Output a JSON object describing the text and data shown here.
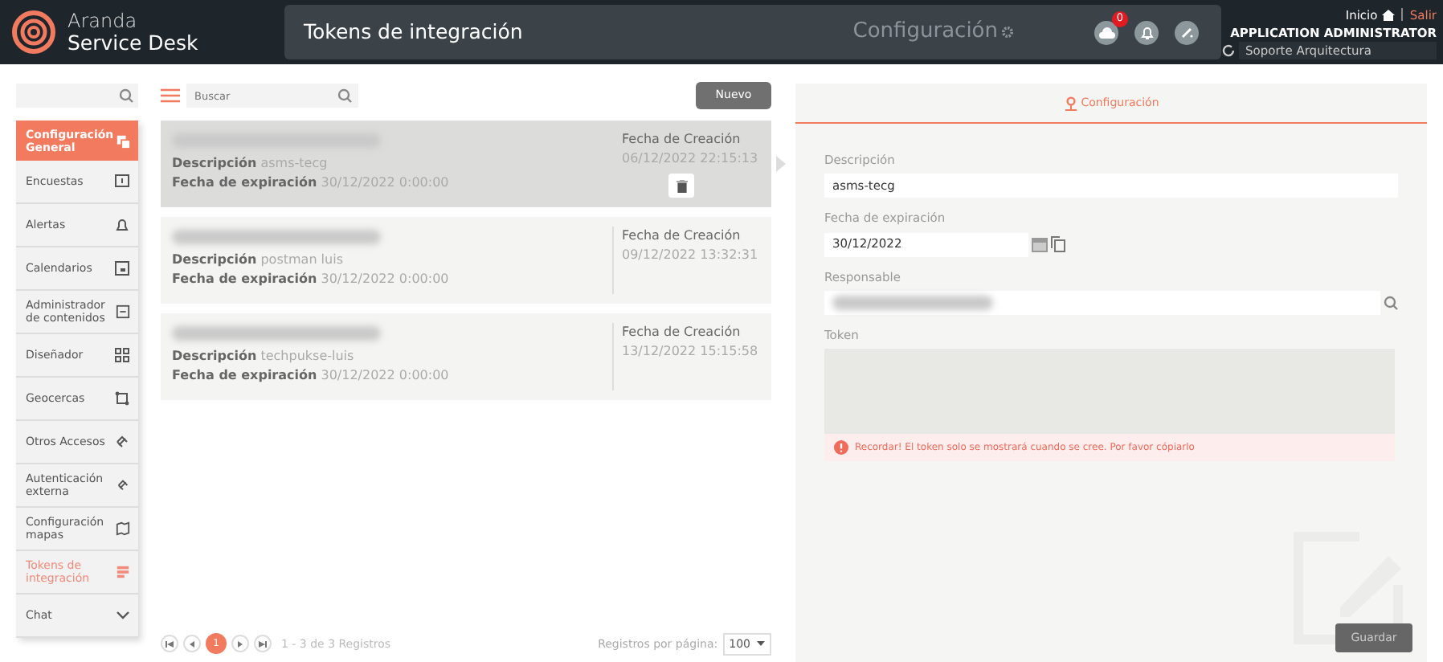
{
  "header": {
    "brand_top": "Aranda",
    "brand_bottom": "Service Desk",
    "title": "Tokens de integración",
    "section": "Configuración",
    "notifications_badge": "0",
    "home_link": "Inicio",
    "logout_link": "Salir",
    "user": "APPLICATION ADMINISTRATOR",
    "project": "Soporte Arquitectura"
  },
  "sidebar": {
    "items": [
      {
        "label": "Configuración General",
        "kind": "section",
        "selected": false
      },
      {
        "label": "Encuestas",
        "kind": "link",
        "selected": false
      },
      {
        "label": "Alertas",
        "kind": "link",
        "selected": false
      },
      {
        "label": "Calendarios",
        "kind": "link",
        "selected": false
      },
      {
        "label": "Administrador de contenidos",
        "kind": "link",
        "selected": false
      },
      {
        "label": "Diseñador",
        "kind": "link",
        "selected": false
      },
      {
        "label": "Geocercas",
        "kind": "link",
        "selected": false
      },
      {
        "label": "Otros Accesos",
        "kind": "link",
        "selected": false
      },
      {
        "label": "Autenticación externa",
        "kind": "link",
        "selected": false
      },
      {
        "label": "Configuración mapas",
        "kind": "link",
        "selected": false
      },
      {
        "label": "Tokens de integración",
        "kind": "link",
        "selected": true
      },
      {
        "label": "Chat",
        "kind": "expandable",
        "selected": false
      }
    ]
  },
  "list": {
    "search_placeholder": "Buscar",
    "new_button": "Nuevo",
    "cards": [
      {
        "description_label": "Descripción",
        "description": "asms-tecg",
        "expiry_label": "Fecha de expiración",
        "expiry": "30/12/2022 0:00:00",
        "created_label": "Fecha de Creación",
        "created": "06/12/2022 22:15:13",
        "selected": true
      },
      {
        "description_label": "Descripción",
        "description": "postman luis",
        "expiry_label": "Fecha de expiración",
        "expiry": "30/12/2022 0:00:00",
        "created_label": "Fecha de Creación",
        "created": "09/12/2022 13:32:31",
        "selected": false
      },
      {
        "description_label": "Descripción",
        "description": "techpukse-luis",
        "expiry_label": "Fecha de expiración",
        "expiry": "30/12/2022 0:00:00",
        "created_label": "Fecha de Creación",
        "created": "13/12/2022 15:15:58",
        "selected": false
      }
    ],
    "pagination": {
      "current_page": "1",
      "summary": "1 - 3 de 3 Registros",
      "per_page_label": "Registros por página:",
      "per_page": "100"
    }
  },
  "detail": {
    "tab": "Configuración",
    "description_label": "Descripción",
    "description": "asms-tecg",
    "expiry_label": "Fecha de expiración",
    "expiry": "30/12/2022",
    "owner_label": "Responsable",
    "token_label": "Token",
    "alert": "Recordar! El token solo se mostrará cuando se cree. Por favor cópiarlo",
    "save_button": "Guardar"
  }
}
